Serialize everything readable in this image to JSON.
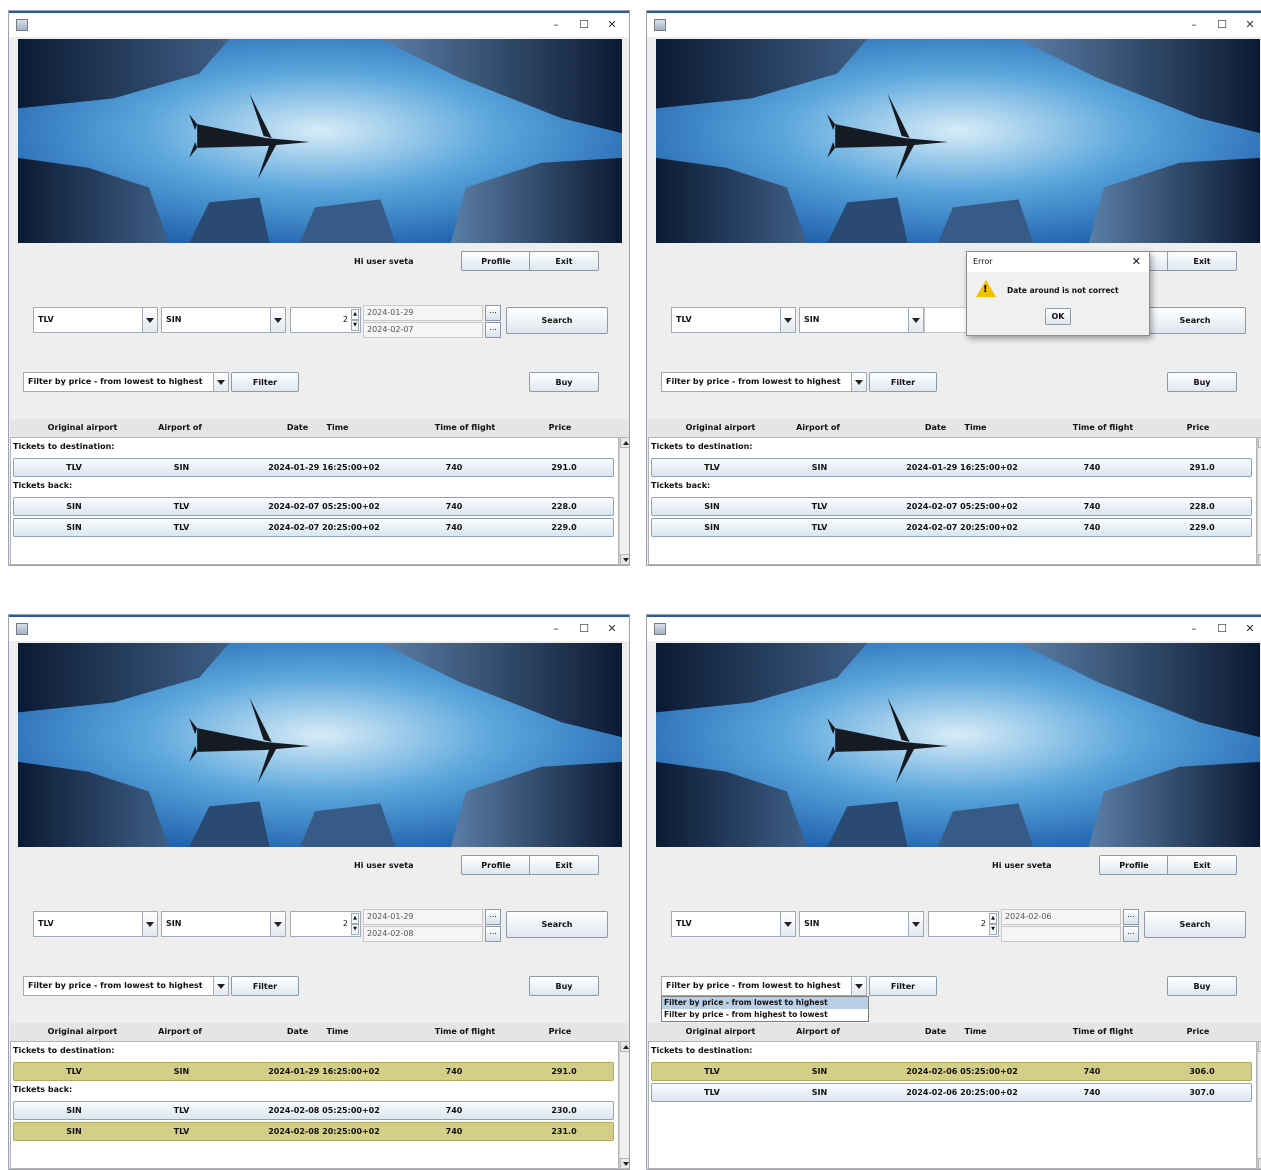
{
  "window": {
    "minimize": "–",
    "maximize": "☐",
    "close": "✕"
  },
  "header": {
    "greeting": "Hi user sveta",
    "profile": "Profile",
    "exit": "Exit"
  },
  "search": {
    "from": "TLV",
    "to": "SIN",
    "passengers": "2",
    "search_label": "Search",
    "date_button": "..."
  },
  "filter": {
    "selected": "Filter by price - from lowest to highest",
    "filter_label": "Filter",
    "buy_label": "Buy",
    "options": [
      "Filter by price - from lowest to highest",
      "Filter by price - from highest to lowest"
    ]
  },
  "table": {
    "columns": [
      "Original airport",
      "Airport of destination",
      "Date",
      "Time",
      "Time of flight",
      "Price"
    ],
    "section_to": "Tickets to destination:",
    "section_back": "Tickets back:"
  },
  "panels": [
    {
      "date1": "2024-01-29",
      "date2": "2024-02-07",
      "to": [
        {
          "from": "TLV",
          "to": "SIN",
          "datetime": "2024-01-29 16:25:00+02",
          "flight": "740",
          "price": "291.0"
        }
      ],
      "back": [
        {
          "from": "SIN",
          "to": "TLV",
          "datetime": "2024-02-07 05:25:00+02",
          "flight": "740",
          "price": "228.0"
        },
        {
          "from": "SIN",
          "to": "TLV",
          "datetime": "2024-02-07 20:25:00+02",
          "flight": "740",
          "price": "229.0"
        }
      ]
    },
    {
      "date1": "",
      "date2": "",
      "to": [
        {
          "from": "TLV",
          "to": "SIN",
          "datetime": "2024-01-29 16:25:00+02",
          "flight": "740",
          "price": "291.0"
        }
      ],
      "back": [
        {
          "from": "SIN",
          "to": "TLV",
          "datetime": "2024-02-07 05:25:00+02",
          "flight": "740",
          "price": "228.0"
        },
        {
          "from": "SIN",
          "to": "TLV",
          "datetime": "2024-02-07 20:25:00+02",
          "flight": "740",
          "price": "229.0"
        }
      ]
    },
    {
      "date1": "2024-01-29",
      "date2": "2024-02-08",
      "to": [
        {
          "from": "TLV",
          "to": "SIN",
          "datetime": "2024-01-29 16:25:00+02",
          "flight": "740",
          "price": "291.0"
        }
      ],
      "back": [
        {
          "from": "SIN",
          "to": "TLV",
          "datetime": "2024-02-08 05:25:00+02",
          "flight": "740",
          "price": "230.0"
        },
        {
          "from": "SIN",
          "to": "TLV",
          "datetime": "2024-02-08 20:25:00+02",
          "flight": "740",
          "price": "231.0"
        }
      ]
    },
    {
      "date1": "2024-02-06",
      "date2": "",
      "to": [
        {
          "from": "TLV",
          "to": "SIN",
          "datetime": "2024-02-06 05:25:00+02",
          "flight": "740",
          "price": "306.0"
        },
        {
          "from": "TLV",
          "to": "SIN",
          "datetime": "2024-02-06 20:25:00+02",
          "flight": "740",
          "price": "307.0"
        }
      ],
      "back": []
    }
  ],
  "error_dialog": {
    "title": "Error",
    "message": "Date around is not correct",
    "ok": "OK",
    "close": "✕",
    "icon": "warning-icon"
  },
  "colors": {
    "highlight": "#d3cf88",
    "row": "#dbe5f1",
    "sky": "#1f6fc4"
  }
}
